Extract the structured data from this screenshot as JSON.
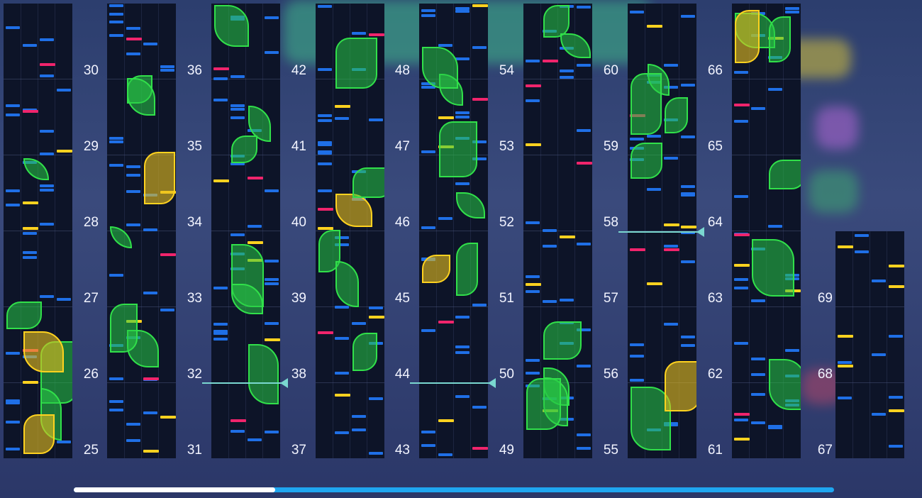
{
  "colors": {
    "blue_note": "#1f6fe6",
    "yellow_note": "#ffd21f",
    "pink_note": "#f0246c",
    "hold_green": "#31e04a",
    "marker": "#7ad8d0"
  },
  "measure_labels": [
    "25",
    "26",
    "27",
    "28",
    "29",
    "30",
    "31",
    "32",
    "33",
    "34",
    "35",
    "36",
    "37",
    "38",
    "39",
    "40",
    "41",
    "42",
    "43",
    "44",
    "45",
    "46",
    "47",
    "48",
    "49",
    "50",
    "51",
    "52",
    "53",
    "54",
    "55",
    "56",
    "57",
    "58",
    "59",
    "60",
    "61",
    "62",
    "63",
    "64",
    "65",
    "66",
    "67",
    "68",
    "69"
  ],
  "scroll_position": 0.265,
  "current_measure_markers": [
    "32",
    "44",
    "58"
  ]
}
